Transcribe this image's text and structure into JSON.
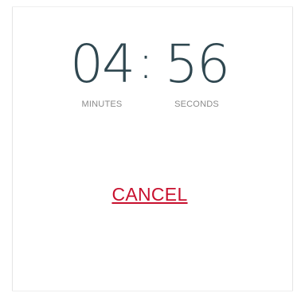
{
  "timer": {
    "minutes": "04",
    "separator": ":",
    "seconds": "56",
    "minutes_label": "MINUTES",
    "seconds_label": "SECONDS"
  },
  "actions": {
    "cancel_label": "CANCEL"
  },
  "colors": {
    "digits": "#2f4750",
    "labels": "#8b8b8b",
    "cancel": "#c8102e",
    "border": "#e4e4e4"
  }
}
